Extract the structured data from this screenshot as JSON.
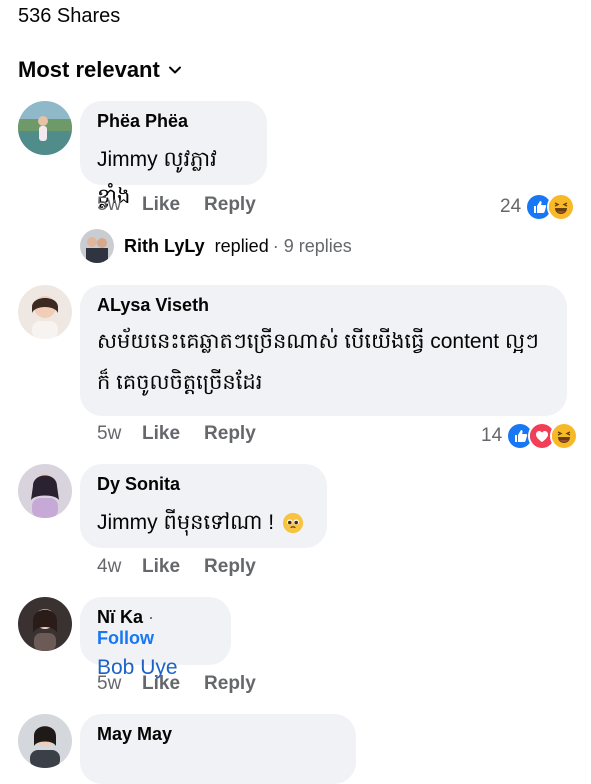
{
  "header": {
    "shares": "536 Shares",
    "sort_label": "Most relevant"
  },
  "comments": [
    {
      "author": "Phëa Phëa",
      "text": "Jimmy លូវភ្លាវខ្លាំង",
      "time": "5w",
      "like": "Like",
      "reply": "Reply",
      "reaction_count": "24",
      "reactions": [
        "like-icon",
        "haha-icon"
      ]
    },
    {
      "author": "ALysa Viseth",
      "text": "សម័យនេះគេឆ្លាតៗច្រើនណាស់ បើយើងធ្វើ content ល្អៗក៏ គេចូលចិត្តច្រើនដែរ",
      "time": "5w",
      "like": "Like",
      "reply": "Reply",
      "reaction_count": "14",
      "reactions": [
        "like-icon",
        "love-icon",
        "haha-icon"
      ]
    },
    {
      "author": "Dy Sonita",
      "text": "Jimmy ពីមុនទៅណា !",
      "emoji": "pleading-face-icon",
      "time": "4w",
      "like": "Like",
      "reply": "Reply"
    },
    {
      "author": "Nï Ka",
      "follow": "Follow",
      "separator": "·",
      "text": "Bob Uye",
      "time": "5w",
      "like": "Like",
      "reply": "Reply"
    },
    {
      "author": "May May"
    }
  ],
  "replies": {
    "name": "Rith LyLy",
    "verb": "replied",
    "count": "· 9 replies"
  },
  "colors": {
    "accent": "#1877f2",
    "bubble": "#f0f2f5",
    "muted": "#65676b"
  }
}
